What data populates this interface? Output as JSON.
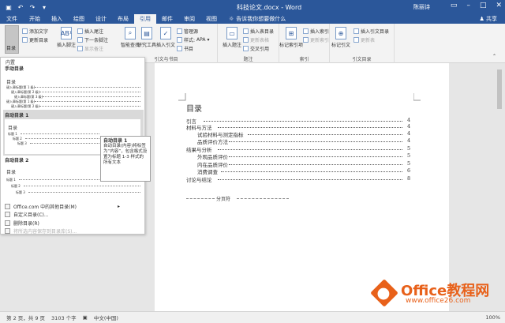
{
  "window": {
    "title": "科技论文.docx - Word",
    "user": "陈丽诗",
    "share_label": "共享",
    "tell_me": "告诉我你想要做什么"
  },
  "tabs": [
    "文件",
    "开始",
    "插入",
    "绘图",
    "设计",
    "布局",
    "引用",
    "邮件",
    "审阅",
    "视图"
  ],
  "active_tab": "引用",
  "ribbon": {
    "toc_label": "目录",
    "add_text": "添加文字",
    "update_toc": "更新目录",
    "insert_footnote": "插入脚注",
    "insert_endnote": "插入尾注",
    "next_footnote": "下一条脚注",
    "show_notes": "显示备注",
    "smart_lookup": "智能查找",
    "researcher": "研究工具",
    "insert_citation": "插入引文",
    "manage_sources": "管理源",
    "style_label": "样式:",
    "style_value": "APA",
    "bibliography": "书目",
    "insert_caption": "插入题注",
    "insert_table_of_figures": "插入表目录",
    "update_table": "更新表格",
    "cross_reference": "交叉引用",
    "insert_index": "插入索引",
    "update_index": "更新索引",
    "mark_entry": "标记索引项",
    "mark_citation": "标记引文",
    "insert_toa": "插入引文目录",
    "update_toa": "更新表",
    "groups": {
      "citations": "引文与书目",
      "captions": "题注",
      "index": "索引",
      "toa": "引文目录"
    }
  },
  "gallery": {
    "header": "内置",
    "manual_title": "手动目录",
    "auto1_title": "自动目录 1",
    "auto2_title": "自动目录 2",
    "preview_heading": "目录",
    "manual_lines": [
      "键入章标题(第 1 级)",
      "键入章标题(第 2 级)",
      "键入章标题(第 3 级)",
      "键入章标题(第 1 级)",
      "键入章标题(第 2 级)",
      "键入章标题(第 3 级)"
    ],
    "auto_lines": [
      "标题 1",
      "标题 2",
      "标题 3"
    ],
    "menu": {
      "more_online": "Office.com 中的其他目录(M)",
      "custom": "自定义目录(C)...",
      "remove": "删除目录(R)",
      "save_selection": "将所选内容保存到目录库(S)..."
    }
  },
  "tooltip": {
    "title": "自动目录 1",
    "body": "自动目录(内容)将标签为“内容”，包含格式设置为标题 1-3 样式的所有文本"
  },
  "document": {
    "heading": "目录",
    "entries": [
      {
        "text": "引言",
        "page": "4",
        "level": 1
      },
      {
        "text": "材料与方法",
        "page": "4",
        "level": 1
      },
      {
        "text": "试验材料与测定指标",
        "page": "4",
        "level": 2
      },
      {
        "text": "品质评价方法",
        "page": "4",
        "level": 2
      },
      {
        "text": "结果与分析",
        "page": "5",
        "level": 1
      },
      {
        "text": "外观品质评价",
        "page": "5",
        "level": 2
      },
      {
        "text": "内在品质评价",
        "page": "5",
        "level": 2
      },
      {
        "text": "消费调查",
        "page": "6",
        "level": 2
      },
      {
        "text": "讨论与结论",
        "page": "8",
        "level": 1
      }
    ],
    "page_break": "分页符"
  },
  "status": {
    "page_info": "第 2 页，共 9 页",
    "word_count": "3103 个字",
    "language": "中文(中国)",
    "zoom": "100%"
  },
  "watermark": {
    "name": "Office教程网",
    "url": "www.office26.com"
  },
  "colors": {
    "word_blue": "#2b579a",
    "brand_orange": "#e8611a"
  }
}
